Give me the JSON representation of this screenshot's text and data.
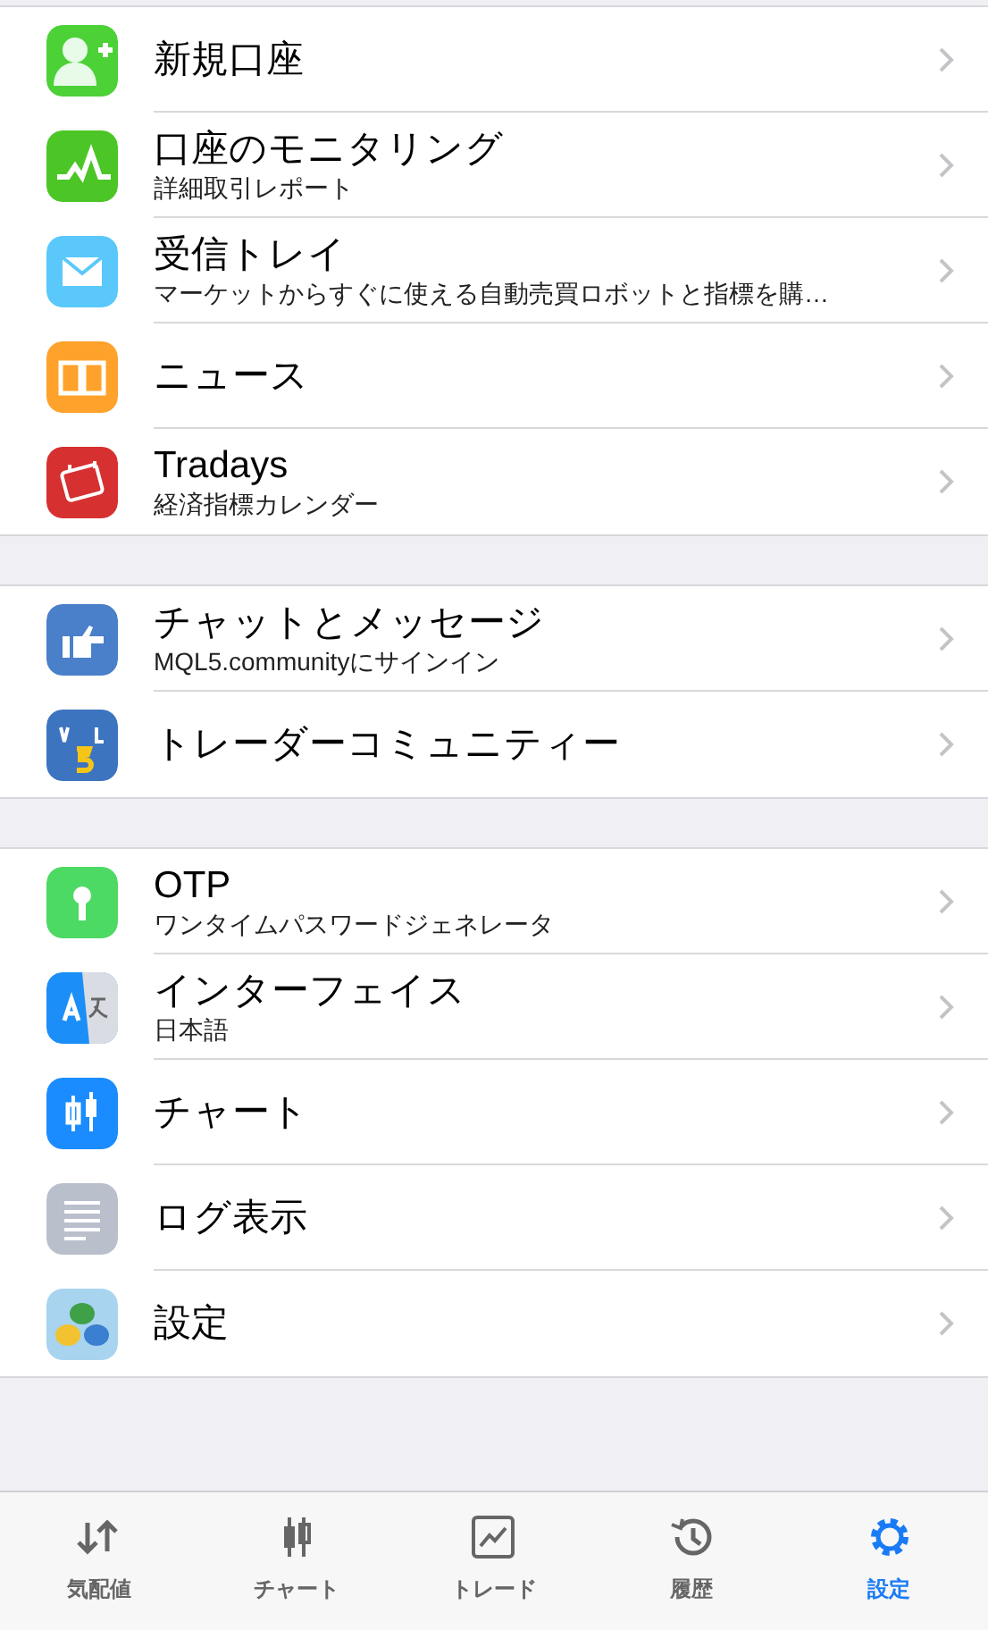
{
  "groups": [
    {
      "items": [
        {
          "title": "新規口座",
          "color": "#4cd137"
        },
        {
          "title": "口座のモニタリング",
          "subtitle": "詳細取引レポート",
          "color": "#4cc626"
        },
        {
          "title": "受信トレイ",
          "subtitle": "マーケットからすぐに使える自動売買ロボットと指標を購…",
          "color": "#5ac8fa"
        },
        {
          "title": "ニュース",
          "color": "#ffa22b"
        },
        {
          "title": "Tradays",
          "subtitle": "経済指標カレンダー",
          "color": "#d63031"
        }
      ]
    },
    {
      "items": [
        {
          "title": "チャットとメッセージ",
          "subtitle": "MQL5.communityにサインイン",
          "color": "#4a7fc9"
        },
        {
          "title": "トレーダーコミュニティー",
          "color": "#3d74c0"
        }
      ]
    },
    {
      "items": [
        {
          "title": "OTP",
          "subtitle": "ワンタイムパスワードジェネレータ",
          "color": "#4cd964"
        },
        {
          "title": "インターフェイス",
          "subtitle": "日本語",
          "color": "#1c8ef7"
        },
        {
          "title": "チャート",
          "color": "#1a8cff"
        },
        {
          "title": "ログ表示",
          "color": "#b9c0cc"
        },
        {
          "title": "設定",
          "color": "#a8d4f0"
        }
      ]
    }
  ],
  "tabs": [
    {
      "label": "気配値",
      "selected": false
    },
    {
      "label": "チャート",
      "selected": false
    },
    {
      "label": "トレード",
      "selected": false
    },
    {
      "label": "履歴",
      "selected": false
    },
    {
      "label": "設定",
      "selected": true
    }
  ]
}
